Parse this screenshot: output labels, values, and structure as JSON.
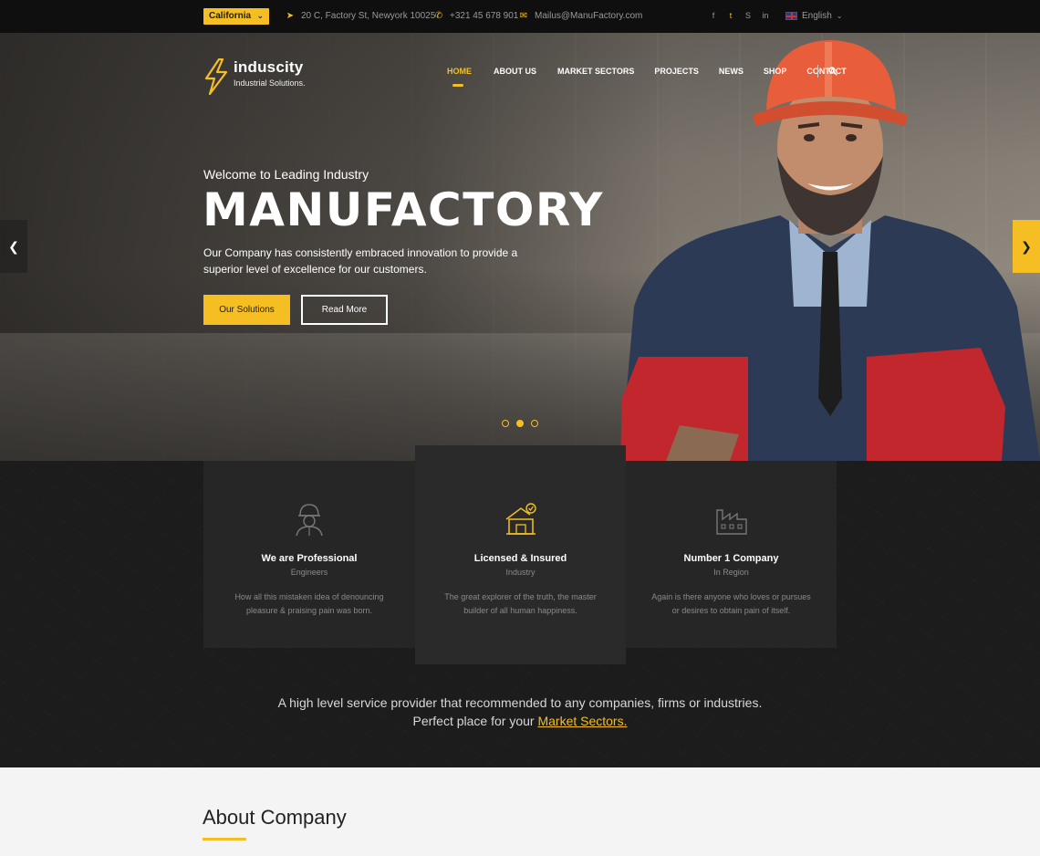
{
  "topbar": {
    "location_select": "California",
    "address": "20 C, Factory St, Newyork 10025",
    "phone": "+321 45 678 901",
    "email": "Mailus@ManuFactory.com",
    "language": "English"
  },
  "brand": {
    "name": "induscity",
    "tagline": "Industrial Solutions."
  },
  "nav": {
    "items": [
      "HOME",
      "ABOUT US",
      "MARKET SECTORS",
      "PROJECTS",
      "NEWS",
      "SHOP",
      "CONTACT"
    ],
    "active_index": 0
  },
  "hero": {
    "welcome": "Welcome to Leading Industry",
    "headline": "MANUFACTORY",
    "description": "Our Company has consistently embraced innovation to provide a superior level of excellence for our customers.",
    "primary_button": "Our Solutions",
    "secondary_button": "Read More",
    "active_slide": 2
  },
  "features": [
    {
      "title": "We are Professional",
      "subtitle": "Engineers",
      "text": "How all this mistaken idea of denouncing pleasure & praising pain was born.",
      "icon": "engineer-icon"
    },
    {
      "title": "Licensed & Insured",
      "subtitle": "Industry",
      "text": "The great explorer of the truth, the master builder of all human happiness.",
      "icon": "certified-house-icon"
    },
    {
      "title": "Number 1 Company",
      "subtitle": "In Region",
      "text": "Again is there anyone who loves or pursues or desires to obtain pain of itself.",
      "icon": "factory-icon"
    }
  ],
  "tagline": {
    "line1": "A high level service provider that recommended to any companies, firms or industries.",
    "line2_prefix": "Perfect place for your",
    "link": "Market Sectors."
  },
  "about": {
    "title": "About Company"
  },
  "colors": {
    "accent": "#f5bf23",
    "dark": "#1c1c1c",
    "topbar": "#0f0f0f"
  }
}
